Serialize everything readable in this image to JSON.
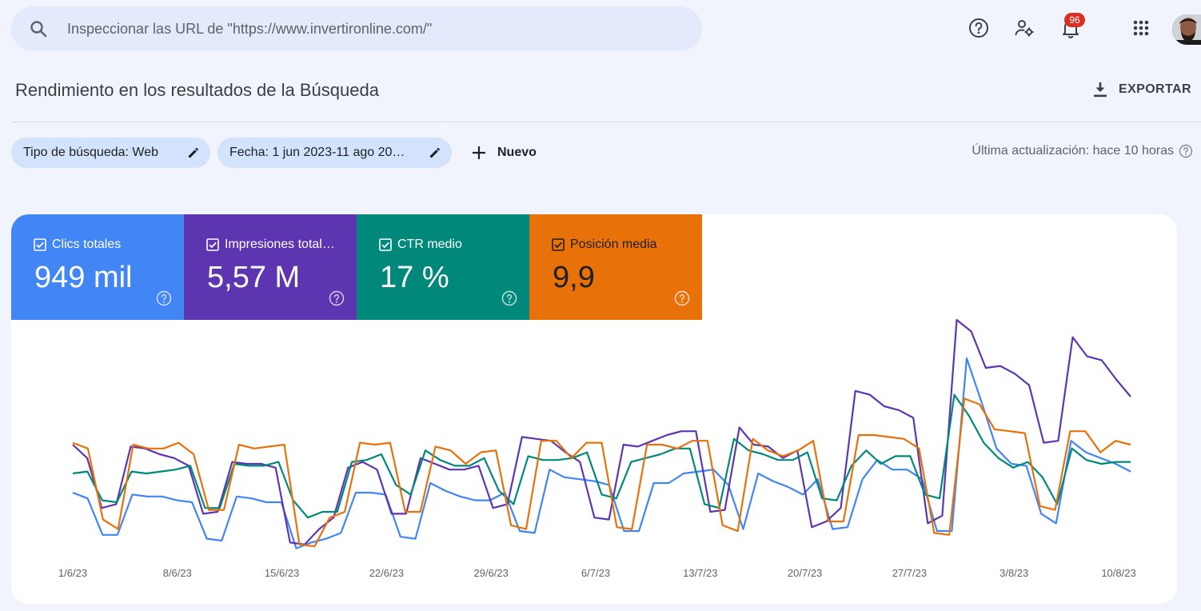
{
  "search": {
    "placeholder": "Inspeccionar las URL de \"https://www.invertironline.com/\""
  },
  "header": {
    "notification_count": "96",
    "icons": [
      "search-icon",
      "help-icon",
      "manage-users-icon",
      "bell-icon",
      "apps-grid-icon",
      "avatar"
    ]
  },
  "page": {
    "title": "Rendimiento en los resultados de la Búsqueda",
    "export_label": "EXPORTAR"
  },
  "filters": {
    "search_type": "Tipo de búsqueda: Web",
    "date": "Fecha: 1 jun 2023-11 ago 20…",
    "new_label": "Nuevo",
    "last_update": "Última actualización: hace 10 horas"
  },
  "metrics": [
    {
      "label": "Clics totales",
      "value": "949 mil",
      "color": "#4285f4",
      "checked": true
    },
    {
      "label": "Impresiones total…",
      "value": "5,57 M",
      "color": "#5e35b1",
      "checked": true
    },
    {
      "label": "CTR medio",
      "value": "17 %",
      "color": "#00897b",
      "checked": true
    },
    {
      "label": "Posición media",
      "value": "9,9",
      "color": "#e8710a",
      "checked": true
    }
  ],
  "chart_data": {
    "type": "line",
    "x_ticks": [
      "1/6/23",
      "8/6/23",
      "15/6/23",
      "22/6/23",
      "29/6/23",
      "6/7/23",
      "13/7/23",
      "20/7/23",
      "27/7/23",
      "3/8/23",
      "10/8/23"
    ],
    "x_start": "2023-06-01",
    "x_end": "2023-08-11",
    "grid": false,
    "legend": "none",
    "series": [
      {
        "name": "Clics totales",
        "color": "#4285f4",
        "values": [
          0.3,
          0.27,
          0.08,
          0.08,
          0.29,
          0.28,
          0.28,
          0.26,
          0.25,
          0.06,
          0.05,
          0.28,
          0.27,
          0.25,
          0.25,
          0.01,
          0.04,
          0.06,
          0.09,
          0.3,
          0.3,
          0.29,
          0.07,
          0.06,
          0.35,
          0.31,
          0.28,
          0.26,
          0.26,
          0.3,
          0.1,
          0.09,
          0.42,
          0.38,
          0.37,
          0.36,
          0.34,
          0.1,
          0.1,
          0.35,
          0.35,
          0.4,
          0.41,
          0.42,
          0.34,
          0.11,
          0.4,
          0.36,
          0.33,
          0.29,
          0.37,
          0.11,
          0.12,
          0.37,
          0.47,
          0.42,
          0.42,
          0.37,
          0.1,
          0.1,
          1.0,
          0.77,
          0.53,
          0.45,
          0.44,
          0.19,
          0.14,
          0.57,
          0.51,
          0.48,
          0.45,
          0.41
        ]
      },
      {
        "name": "Impresiones totales",
        "color": "#5e35b1",
        "values": [
          0.55,
          0.48,
          0.22,
          0.24,
          0.54,
          0.53,
          0.5,
          0.48,
          0.44,
          0.19,
          0.2,
          0.46,
          0.45,
          0.45,
          0.43,
          0.04,
          0.03,
          0.11,
          0.17,
          0.43,
          0.46,
          0.42,
          0.19,
          0.19,
          0.48,
          0.45,
          0.42,
          0.42,
          0.44,
          0.22,
          0.24,
          0.59,
          0.58,
          0.57,
          0.51,
          0.46,
          0.17,
          0.16,
          0.55,
          0.54,
          0.57,
          0.6,
          0.62,
          0.62,
          0.2,
          0.21,
          0.64,
          0.55,
          0.54,
          0.48,
          0.52,
          0.12,
          0.15,
          0.22,
          0.83,
          0.81,
          0.75,
          0.73,
          0.69,
          0.14,
          0.18,
          1.2,
          1.14,
          0.95,
          0.96,
          0.92,
          0.86,
          0.56,
          0.57,
          1.11,
          1.01,
          0.99,
          0.89,
          0.8
        ]
      },
      {
        "name": "CTR medio",
        "color": "#00897b",
        "values": [
          0.4,
          0.41,
          0.26,
          0.25,
          0.41,
          0.4,
          0.41,
          0.42,
          0.44,
          0.22,
          0.22,
          0.45,
          0.44,
          0.44,
          0.46,
          0.26,
          0.17,
          0.2,
          0.2,
          0.46,
          0.47,
          0.5,
          0.34,
          0.29,
          0.52,
          0.47,
          0.44,
          0.44,
          0.48,
          0.31,
          0.24,
          0.49,
          0.47,
          0.47,
          0.48,
          0.51,
          0.29,
          0.27,
          0.46,
          0.48,
          0.5,
          0.53,
          0.53,
          0.24,
          0.22,
          0.58,
          0.52,
          0.5,
          0.47,
          0.47,
          0.51,
          0.27,
          0.26,
          0.44,
          0.52,
          0.45,
          0.49,
          0.49,
          0.29,
          0.27,
          0.81,
          0.7,
          0.56,
          0.48,
          0.43,
          0.46,
          0.38,
          0.24,
          0.53,
          0.47,
          0.45,
          0.46,
          0.46
        ]
      },
      {
        "name": "Posición media",
        "color": "#e8710a",
        "values": [
          0.56,
          0.53,
          0.16,
          0.11,
          0.55,
          0.53,
          0.53,
          0.56,
          0.5,
          0.21,
          0.21,
          0.55,
          0.53,
          0.54,
          0.55,
          0.03,
          0.02,
          0.17,
          0.2,
          0.56,
          0.55,
          0.56,
          0.2,
          0.2,
          0.54,
          0.52,
          0.45,
          0.51,
          0.52,
          0.13,
          0.11,
          0.57,
          0.57,
          0.48,
          0.56,
          0.56,
          0.12,
          0.11,
          0.55,
          0.55,
          0.53,
          0.57,
          0.57,
          0.13,
          0.1,
          0.58,
          0.52,
          0.49,
          0.52,
          0.57,
          0.15,
          0.15,
          0.6,
          0.6,
          0.59,
          0.58,
          0.53,
          0.09,
          0.08,
          0.79,
          0.76,
          0.63,
          0.62,
          0.61,
          0.23,
          0.21,
          0.62,
          0.62,
          0.51,
          0.57,
          0.55
        ]
      }
    ]
  }
}
